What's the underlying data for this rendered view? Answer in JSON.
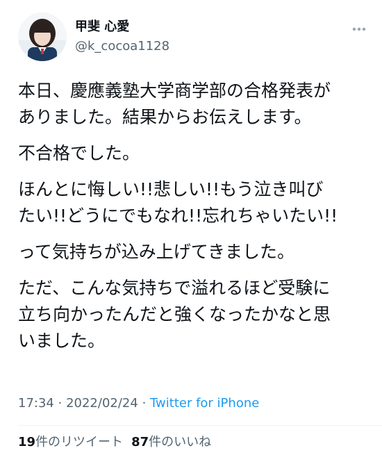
{
  "author": {
    "display_name": "甲斐 心愛",
    "handle": "@k_cocoa1128"
  },
  "tweet": {
    "paragraphs": [
      [
        "本日、慶應義塾大学商学部の合格発表が",
        "ありました。結果からお伝えします。"
      ],
      [
        "不合格でした。"
      ],
      [
        "ほんとに悔しい!!悲しい!!もう泣き叫び",
        "たい!!どうにでもなれ!!忘れちゃいたい!!"
      ],
      [
        "って気持ちが込み上げてきました。"
      ],
      [
        "ただ、こんな気持ちで溢れるほど受験に",
        "立ち向かったんだと強くなったかなと思",
        "いました。"
      ]
    ],
    "time": "17:34",
    "separator": "·",
    "date": "2022/02/24",
    "source": "Twitter for iPhone"
  },
  "stats": {
    "retweets_count": "19",
    "retweets_label": "件のリツイート",
    "likes_count": "87",
    "likes_label": "件のいいね"
  },
  "icons": {
    "more": "more-horizontal-icon"
  },
  "colors": {
    "text": "#0f1419",
    "secondary": "#536471",
    "link": "#1d9bf0",
    "divider": "#eff3f4"
  }
}
